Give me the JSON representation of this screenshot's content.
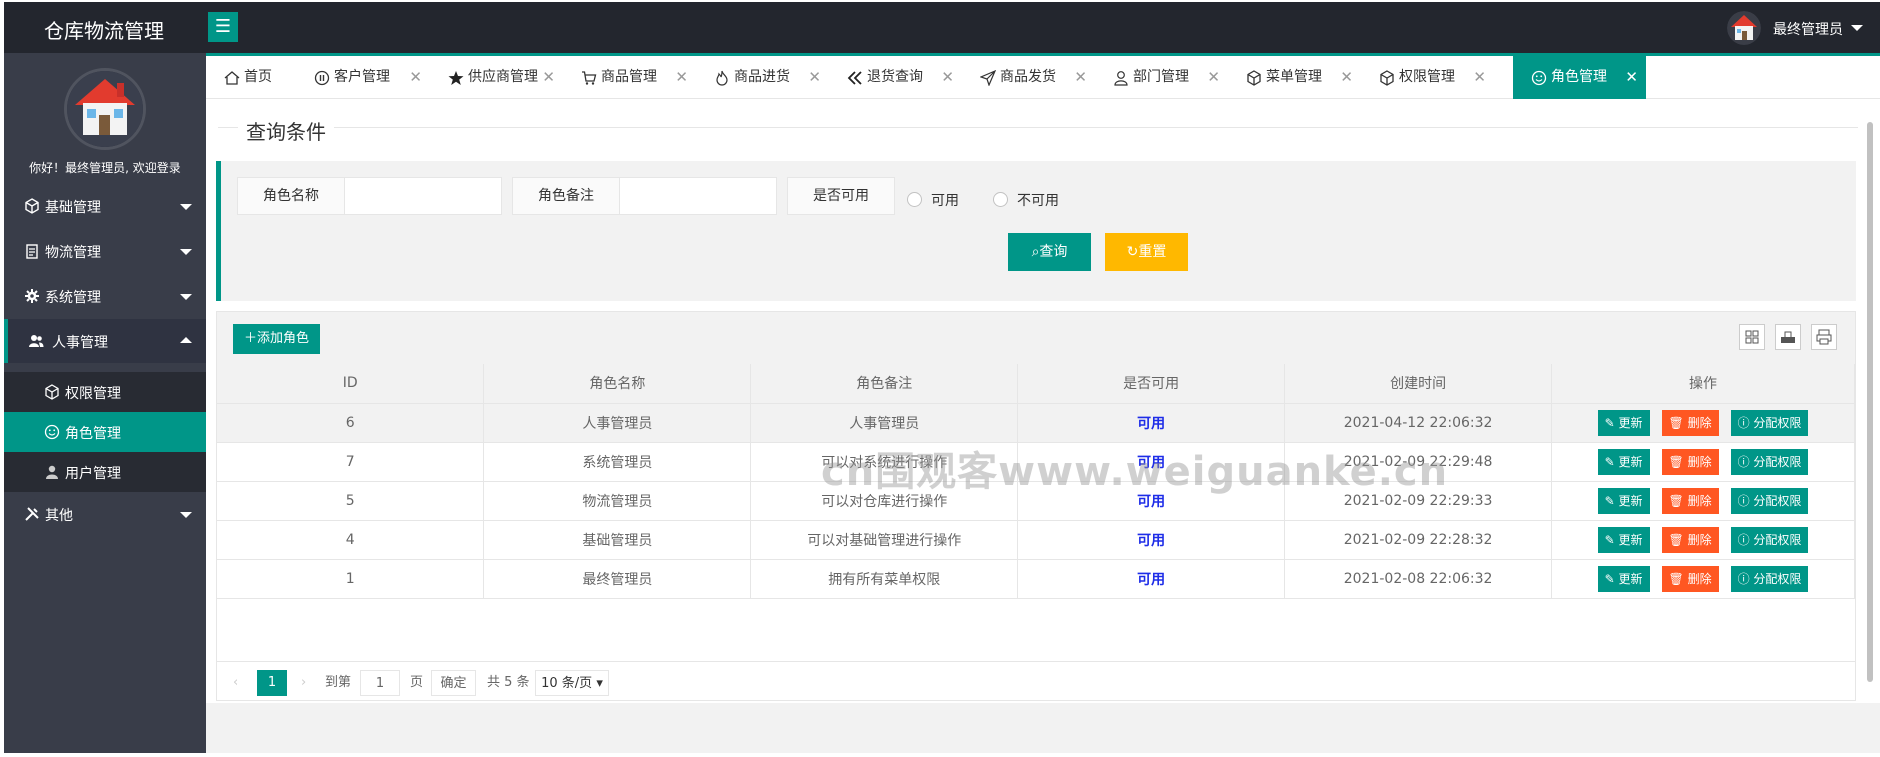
{
  "app": {
    "title": "仓库物流管理",
    "user": "最终管理员"
  },
  "sidebar": {
    "welcome": "你好！最终管理员, 欢迎登录",
    "items": [
      {
        "label": "基础管理",
        "icon": "cube-icon"
      },
      {
        "label": "物流管理",
        "icon": "clipboard-icon"
      },
      {
        "label": "系统管理",
        "icon": "gear-icon"
      },
      {
        "label": "人事管理",
        "icon": "users-icon"
      },
      {
        "label": "其他",
        "icon": "tools-icon"
      }
    ],
    "sub": [
      {
        "label": "权限管理",
        "icon": "cube-icon"
      },
      {
        "label": "角色管理",
        "icon": "smile-icon"
      },
      {
        "label": "用户管理",
        "icon": "user-icon"
      }
    ]
  },
  "tabs": [
    {
      "label": "首页",
      "icon": "home-icon"
    },
    {
      "label": "客户管理",
      "icon": "pause-circle-icon"
    },
    {
      "label": "供应商管理",
      "icon": "star-icon"
    },
    {
      "label": "商品管理",
      "icon": "cart-icon"
    },
    {
      "label": "商品进货",
      "icon": "fire-icon"
    },
    {
      "label": "退货查询",
      "icon": "double-left-icon"
    },
    {
      "label": "商品发货",
      "icon": "send-icon"
    },
    {
      "label": "部门管理",
      "icon": "user-outline-icon"
    },
    {
      "label": "菜单管理",
      "icon": "cube-icon"
    },
    {
      "label": "权限管理",
      "icon": "cube-icon"
    },
    {
      "label": "角色管理",
      "icon": "smile-icon"
    }
  ],
  "search": {
    "legend": "查询条件",
    "role_name_label": "角色名称",
    "role_remark_label": "角色备注",
    "available_label": "是否可用",
    "radio_yes": "可用",
    "radio_no": "不可用",
    "query_button": "查询",
    "reset_button": "重置"
  },
  "toolbar": {
    "add_button": "添加角色"
  },
  "table": {
    "headers": [
      "ID",
      "角色名称",
      "角色备注",
      "是否可用",
      "创建时间",
      "操作"
    ],
    "rows": [
      {
        "id": "6",
        "name": "人事管理员",
        "remark": "人事管理员",
        "status": "可用",
        "time": "2021-04-12 22:06:32"
      },
      {
        "id": "7",
        "name": "系统管理员",
        "remark": "可以对系统进行操作",
        "status": "可用",
        "time": "2021-02-09 22:29:48"
      },
      {
        "id": "5",
        "name": "物流管理员",
        "remark": "可以对仓库进行操作",
        "status": "可用",
        "time": "2021-02-09 22:29:33"
      },
      {
        "id": "4",
        "name": "基础管理员",
        "remark": "可以对基础管理进行操作",
        "status": "可用",
        "time": "2021-02-09 22:28:32"
      },
      {
        "id": "1",
        "name": "最终管理员",
        "remark": "拥有所有菜单权限",
        "status": "可用",
        "time": "2021-02-08 22:06:32"
      }
    ],
    "actions": {
      "update": "更新",
      "delete": "删除",
      "assign": "分配权限"
    }
  },
  "pager": {
    "current": "1",
    "goto_label": "到第",
    "page_value": "1",
    "page_unit": "页",
    "confirm": "确定",
    "total": "共 5 条",
    "per_page": "10 条/页"
  },
  "watermark": "cn围观客www.weiguanke.cn",
  "colors": {
    "accent": "#009688",
    "header": "#23262e",
    "sidebar": "#393d49",
    "danger": "#ff5722",
    "warn": "#ffb800",
    "status": "#1e2de8"
  }
}
